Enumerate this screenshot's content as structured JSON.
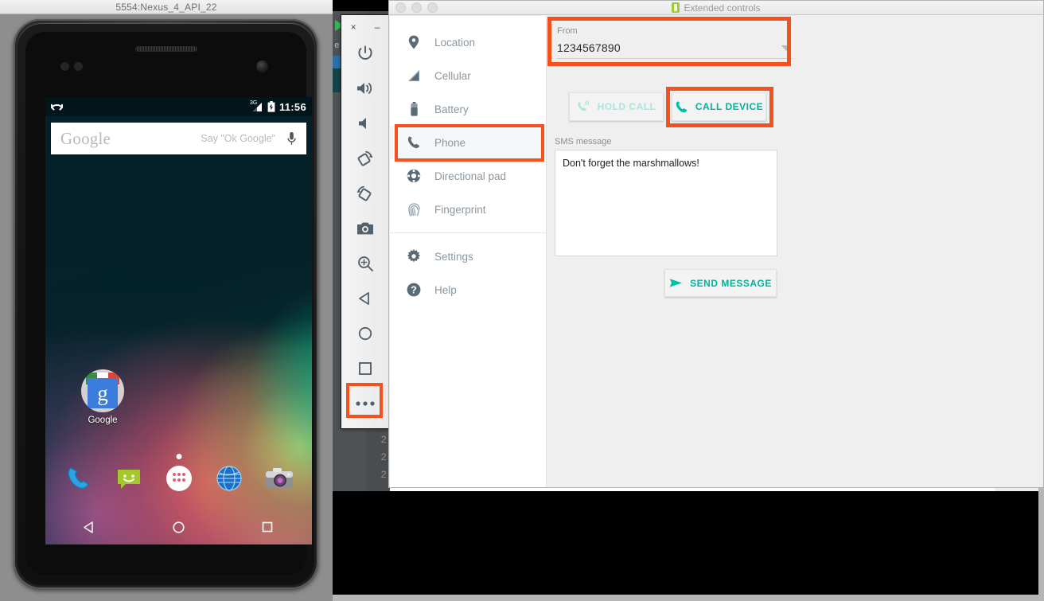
{
  "emulator_window": {
    "title": "5554:Nexus_4_API_22",
    "toolbar": {
      "close_label": "×",
      "minimize_label": "–",
      "buttons": [
        {
          "name": "power-button",
          "icon": "power-icon",
          "tooltip": "Power"
        },
        {
          "name": "volume-up-button",
          "icon": "volume-up-icon",
          "tooltip": "Volume Up"
        },
        {
          "name": "volume-down-button",
          "icon": "volume-down-icon",
          "tooltip": "Volume Down"
        },
        {
          "name": "rotate-left-button",
          "icon": "rotate-left-icon",
          "tooltip": "Rotate Left"
        },
        {
          "name": "rotate-right-button",
          "icon": "rotate-right-icon",
          "tooltip": "Rotate Right"
        },
        {
          "name": "screenshot-button",
          "icon": "camera-icon",
          "tooltip": "Take Screenshot"
        },
        {
          "name": "zoom-button",
          "icon": "zoom-in-icon",
          "tooltip": "Zoom Mode"
        },
        {
          "name": "back-button",
          "icon": "back-triangle-icon",
          "tooltip": "Back"
        },
        {
          "name": "home-button",
          "icon": "home-circle-icon",
          "tooltip": "Home"
        },
        {
          "name": "overview-button",
          "icon": "overview-square-icon",
          "tooltip": "Overview"
        },
        {
          "name": "more-button",
          "icon": "ellipsis-icon",
          "tooltip": "More"
        }
      ]
    },
    "device_screen": {
      "status_bar": {
        "notification_icon": "missed-call-icon",
        "network_label": "3G",
        "signal_icon": "signal-bars-icon",
        "battery_icon": "battery-charging-icon",
        "clock": "11:56"
      },
      "search_widget": {
        "logo_text": "Google",
        "hint_text": "Say \"Ok Google\"",
        "mic_icon": "microphone-icon"
      },
      "home_icons": [
        {
          "label": "Google",
          "icon": "google-folder-icon"
        }
      ],
      "page_indicator_dots": 1,
      "dock": [
        {
          "name": "phone-app",
          "icon": "phone-handset-icon"
        },
        {
          "name": "messaging-app",
          "icon": "message-bubble-icon"
        },
        {
          "name": "app-drawer",
          "icon": "app-drawer-icon"
        },
        {
          "name": "browser-app",
          "icon": "globe-icon"
        },
        {
          "name": "camera-app",
          "icon": "camera-app-icon"
        }
      ],
      "nav_bar": [
        {
          "name": "nav-back",
          "icon": "back-triangle-icon"
        },
        {
          "name": "nav-home",
          "icon": "home-circle-icon"
        },
        {
          "name": "nav-recents",
          "icon": "recents-square-icon"
        }
      ]
    }
  },
  "extended_controls": {
    "title": "Extended controls",
    "title_icon": "android-device-icon",
    "window_buttons": [
      "close",
      "minimize",
      "maximize"
    ],
    "sidebar": {
      "items": [
        {
          "label": "Location",
          "icon": "map-pin-icon",
          "selected": false
        },
        {
          "label": "Cellular",
          "icon": "signal-bars-icon",
          "selected": false
        },
        {
          "label": "Battery",
          "icon": "battery-icon",
          "selected": false
        },
        {
          "label": "Phone",
          "icon": "phone-handset-icon",
          "selected": true
        },
        {
          "label": "Directional pad",
          "icon": "dpad-icon",
          "selected": false
        },
        {
          "label": "Fingerprint",
          "icon": "fingerprint-icon",
          "selected": false
        }
      ],
      "footer_items": [
        {
          "label": "Settings",
          "icon": "gear-icon"
        },
        {
          "label": "Help",
          "icon": "question-circle-icon"
        }
      ]
    },
    "phone_panel": {
      "from_label": "From",
      "from_value": "1234567890",
      "from_dropdown_icon": "chevron-down-icon",
      "hold_call_label": "HOLD CALL",
      "hold_call_icon": "call-hold-icon",
      "hold_call_enabled": false,
      "call_device_label": "CALL DEVICE",
      "call_device_icon": "phone-handset-icon",
      "call_device_enabled": true,
      "sms_label": "SMS message",
      "sms_value": "Don't forget the marshmallows!",
      "send_message_label": "SEND MESSAGE",
      "send_message_icon": "send-arrow-icon"
    }
  },
  "annotations": {
    "highlight_color": "#f4511e",
    "highlighted_regions": [
      "from-field",
      "call-device-button",
      "sidebar-phone-item",
      "toolbar-more-button"
    ]
  },
  "theme": {
    "accent_teal": "#00b39a",
    "disabled_teal": "#a8e6dc",
    "sidebar_text": "#8a97a0",
    "panel_bg": "#efefef"
  }
}
